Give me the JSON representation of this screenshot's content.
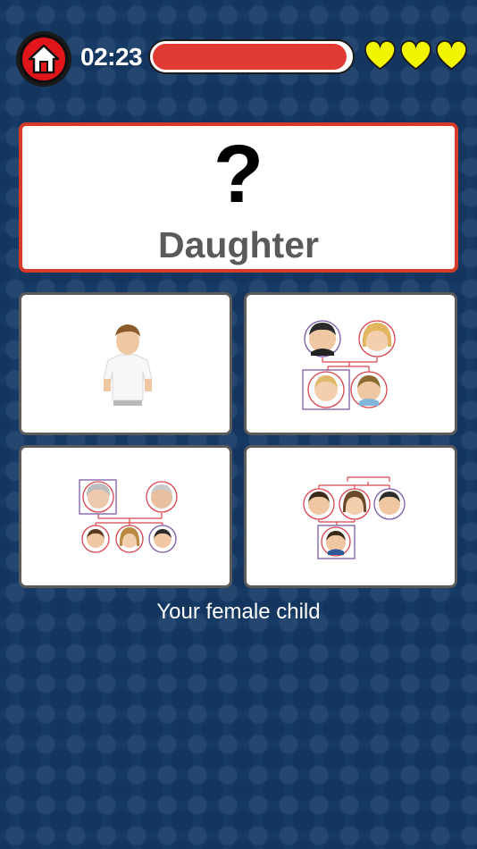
{
  "header": {
    "timer": "02:23",
    "progress_fraction": 0.98,
    "lives_total": 3,
    "lives_remaining": 3
  },
  "prompt": {
    "symbol": "?",
    "word": "Daughter"
  },
  "options": [
    {
      "depicts": "boy-photo"
    },
    {
      "depicts": "family-tree-parents-two-children"
    },
    {
      "depicts": "family-tree-grandparents"
    },
    {
      "depicts": "family-tree-siblings-one-child"
    }
  ],
  "hint": "Your female child",
  "colors": {
    "background": "#163a66",
    "accent_red": "#e03a33",
    "card_border_highlight": "#d83a2a",
    "heart": "#f3f500",
    "tree_line_red": "#d9434e",
    "tree_line_purple": "#7a5aa6"
  },
  "icons": {
    "home": "home-icon",
    "heart": "heart-icon"
  }
}
